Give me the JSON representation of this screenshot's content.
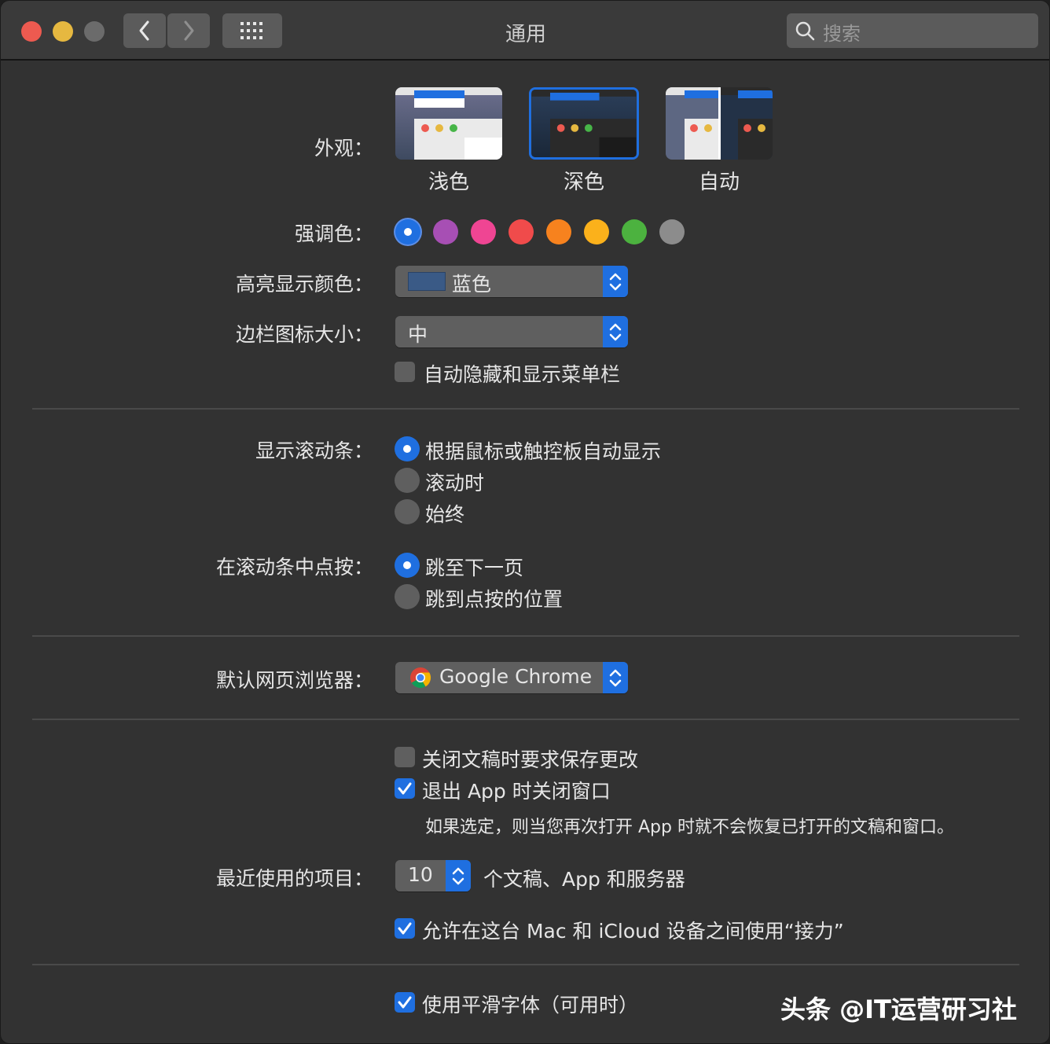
{
  "window": {
    "title": "通用",
    "search_placeholder": "搜索",
    "traffic_lights": {
      "close": "#ed5a50",
      "minimize": "#e6b840",
      "zoom": "#6b6b6b"
    }
  },
  "appearance": {
    "label": "外观：",
    "options": [
      {
        "name": "浅色",
        "selected": false
      },
      {
        "name": "深色",
        "selected": true
      },
      {
        "name": "自动",
        "selected": false
      }
    ]
  },
  "accent": {
    "label": "强调色：",
    "colors": [
      "#1f6fe0",
      "#a74fb4",
      "#ef4593",
      "#f04b4b",
      "#f7821e",
      "#fbb11b",
      "#4cb23f",
      "#8c8c8c"
    ],
    "selected_index": 0
  },
  "highlight": {
    "label": "高亮显示颜色：",
    "value": "蓝色",
    "swatch": "#3a5a86"
  },
  "sidebar_icon_size": {
    "label": "边栏图标大小：",
    "value": "中"
  },
  "auto_hide_menubar": {
    "label": "自动隐藏和显示菜单栏",
    "checked": false
  },
  "show_scrollbars": {
    "label": "显示滚动条：",
    "options": [
      "根据鼠标或触控板自动显示",
      "滚动时",
      "始终"
    ],
    "selected_index": 0
  },
  "click_in_scrollbar": {
    "label": "在滚动条中点按：",
    "options": [
      "跳至下一页",
      "跳到点按的位置"
    ],
    "selected_index": 0
  },
  "default_browser": {
    "label": "默认网页浏览器：",
    "value": "Google Chrome"
  },
  "ask_keep_changes": {
    "label": "关闭文稿时要求保存更改",
    "checked": false
  },
  "close_windows": {
    "label": "退出 App 时关闭窗口",
    "checked": true,
    "note": "如果选定，则当您再次打开 App 时就不会恢复已打开的文稿和窗口。"
  },
  "recent_items": {
    "label": "最近使用的项目：",
    "value": "10",
    "suffix": "个文稿、App 和服务器"
  },
  "handoff": {
    "label": "允许在这台 Mac 和 iCloud 设备之间使用“接力”",
    "checked": true
  },
  "font_smoothing": {
    "label": "使用平滑字体（可用时）",
    "checked": true
  },
  "watermark": "头条 @IT运营研习社"
}
